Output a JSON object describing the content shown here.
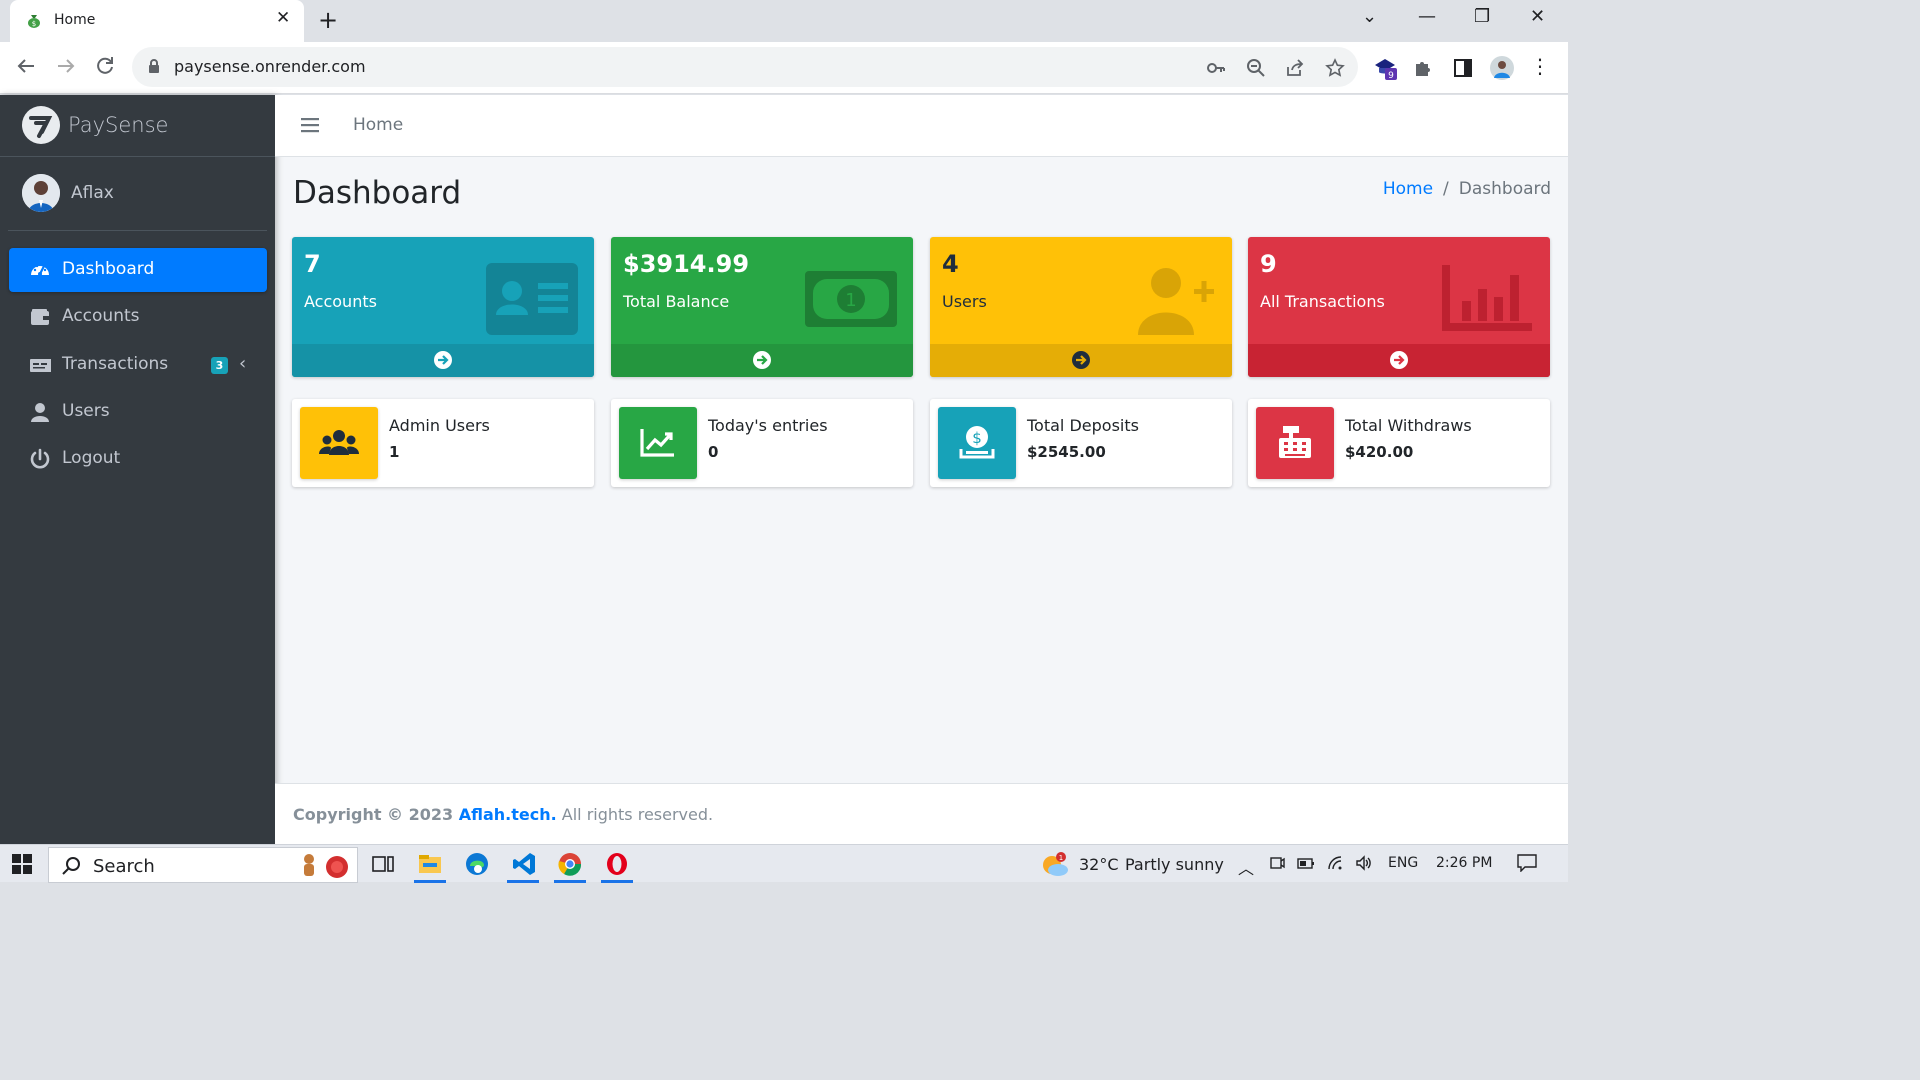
{
  "browser": {
    "tab_title": "Home",
    "url": "paysense.onrender.com",
    "extension_badge": "9"
  },
  "sidebar": {
    "brand": "PaySense",
    "user": "Aflax",
    "items": [
      {
        "label": "Dashboard",
        "icon": "tachometer-icon",
        "active": true
      },
      {
        "label": "Accounts",
        "icon": "wallet-icon"
      },
      {
        "label": "Transactions",
        "icon": "money-check-icon",
        "badge": "3"
      },
      {
        "label": "Users",
        "icon": "user-icon"
      },
      {
        "label": "Logout",
        "icon": "power-icon"
      }
    ]
  },
  "topnav": {
    "home": "Home"
  },
  "page": {
    "title": "Dashboard",
    "breadcrumb": [
      "Home",
      "Dashboard"
    ]
  },
  "small_boxes": [
    {
      "value": "7",
      "label": "Accounts",
      "color": "#17a2b8",
      "icon": "id-card-icon"
    },
    {
      "value": "$3914.99",
      "label": "Total Balance",
      "color": "#28a745",
      "icon": "money-bill-icon"
    },
    {
      "value": "4",
      "label": "Users",
      "color": "#ffc107",
      "icon": "user-plus-icon"
    },
    {
      "value": "9",
      "label": "All Transactions",
      "color": "#dc3545",
      "icon": "chart-bar-icon"
    }
  ],
  "info_boxes": [
    {
      "title": "Admin Users",
      "number": "1",
      "color": "#ffc107",
      "icon": "users-icon"
    },
    {
      "title": "Today's entries",
      "number": "0",
      "color": "#28a745",
      "icon": "chart-line-icon"
    },
    {
      "title": "Total Deposits",
      "number": "$2545.00",
      "color": "#17a2b8",
      "icon": "hand-holding-dollar-icon"
    },
    {
      "title": "Total Withdraws",
      "number": "$420.00",
      "color": "#dc3545",
      "icon": "cash-register-icon"
    }
  ],
  "footer": {
    "prefix": "Copyright © 2023 ",
    "link": "Aflah.tech.",
    "suffix": " All rights reserved."
  },
  "taskbar": {
    "search": "Search",
    "temperature": "32°C",
    "weather": "Partly sunny",
    "weather_badge": "1",
    "language": "ENG",
    "time": "2:26 PM"
  }
}
